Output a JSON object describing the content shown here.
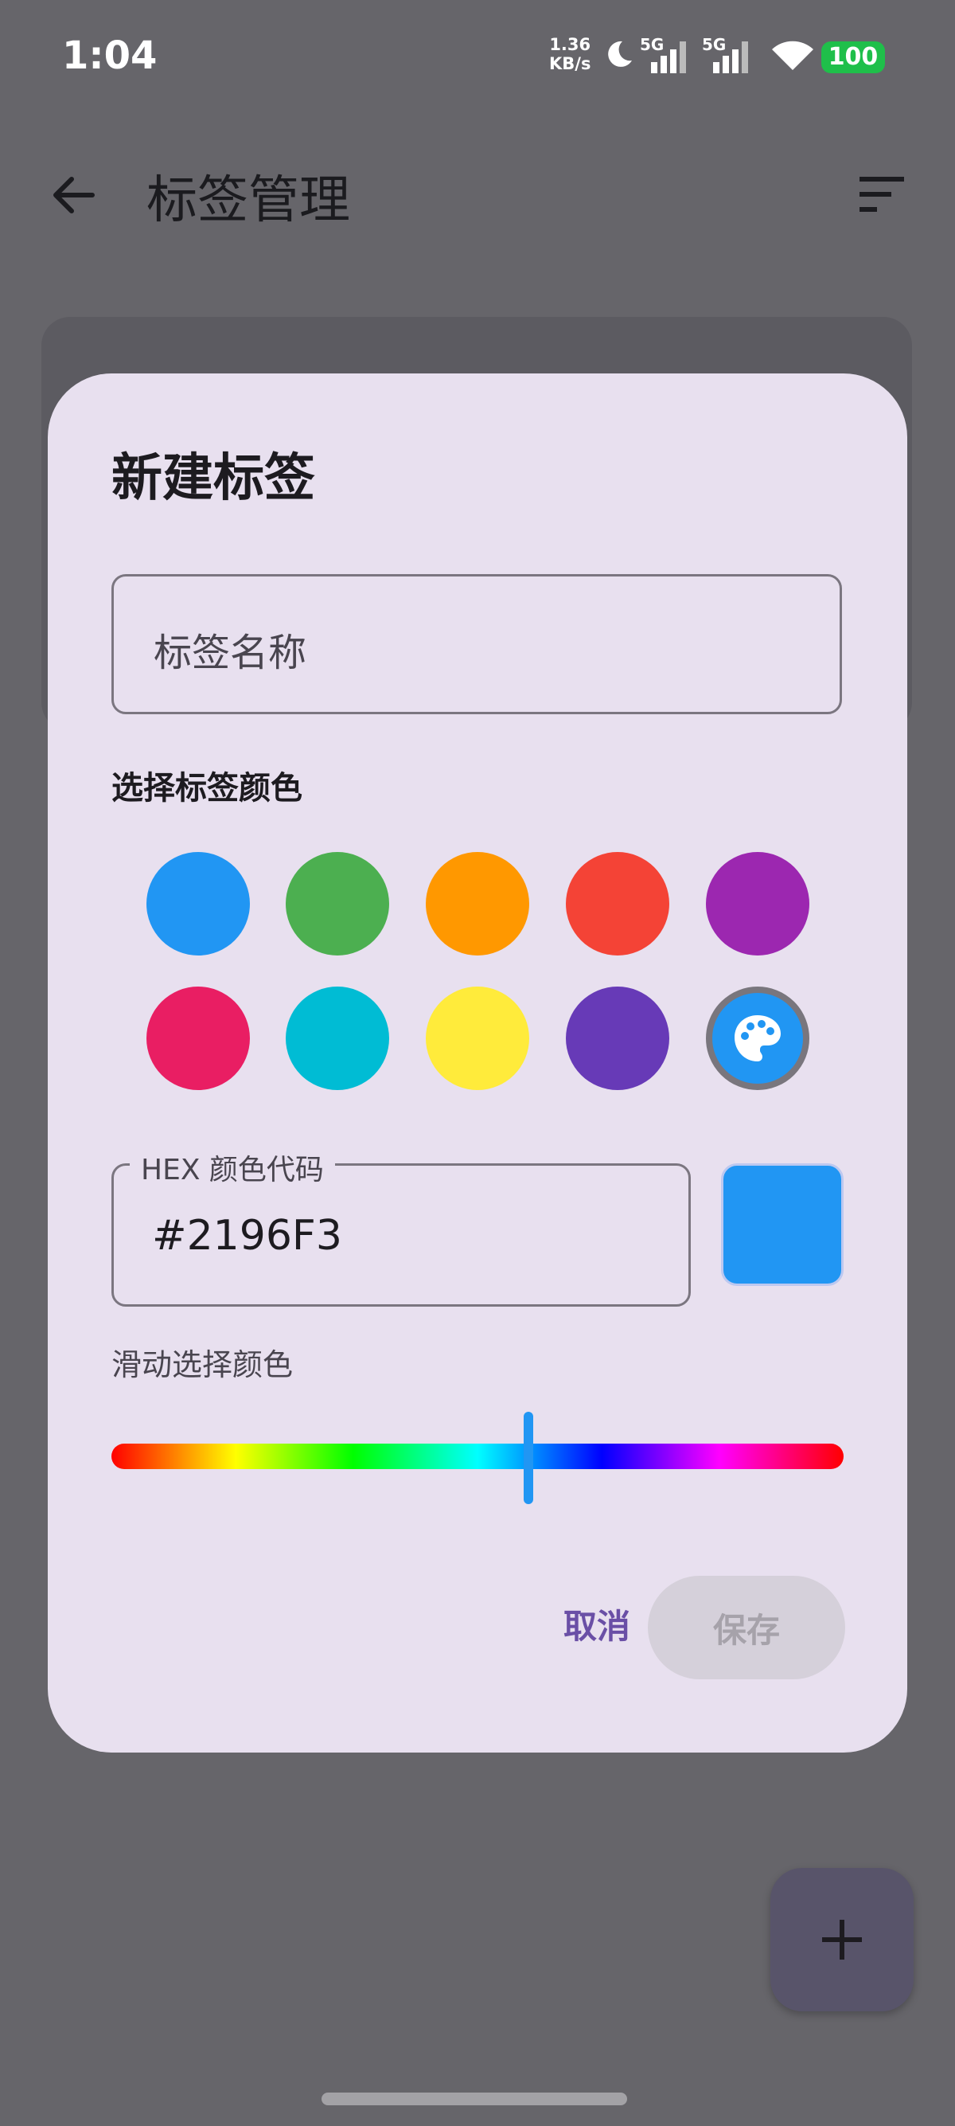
{
  "status_bar": {
    "time": "1:04",
    "net_speed_value": "1.36",
    "net_speed_unit": "KB/s",
    "signal1_label": "5G",
    "signal2_label": "5G",
    "battery": "100"
  },
  "app_bar": {
    "title": "标签管理"
  },
  "dialog": {
    "title": "新建标签",
    "name_placeholder": "标签名称",
    "color_section_label": "选择标签颜色",
    "swatches": [
      "#2196F3",
      "#4CAF50",
      "#FF9800",
      "#F44336",
      "#9C27B0",
      "#E91E63",
      "#00BCD4",
      "#FFEB3B",
      "#673AB7"
    ],
    "custom_swatch_color": "#2196F3",
    "custom_swatch_icon": "palette-icon",
    "hex_label": "HEX 颜色代码",
    "hex_value": "#2196F3",
    "preview_color": "#2196F3",
    "slider_label": "滑动选择颜色",
    "hue_position": 0.57,
    "cancel_label": "取消",
    "save_label": "保存"
  },
  "fab": {
    "icon": "plus-icon"
  }
}
